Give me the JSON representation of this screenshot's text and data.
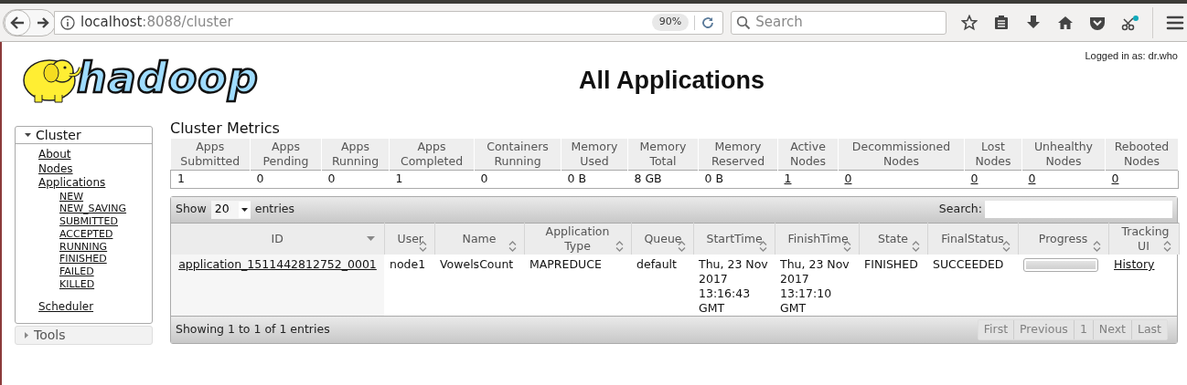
{
  "browser": {
    "url_host": "localhost",
    "url_path": ":8088/cluster",
    "zoom": "90%",
    "search_placeholder": "Search"
  },
  "header": {
    "logo_text": "hadoop",
    "logged_in": "Logged in as: dr.who",
    "title": "All Applications"
  },
  "sidebar": [
    {
      "label": "Cluster",
      "expanded": true,
      "items": [
        {
          "label": "About"
        },
        {
          "label": "Nodes"
        },
        {
          "label": "Applications",
          "children": [
            {
              "label": "NEW"
            },
            {
              "label": "NEW_SAVING"
            },
            {
              "label": "SUBMITTED"
            },
            {
              "label": "ACCEPTED"
            },
            {
              "label": "RUNNING"
            },
            {
              "label": "FINISHED"
            },
            {
              "label": "FAILED"
            },
            {
              "label": "KILLED"
            }
          ]
        },
        {
          "label": "Scheduler"
        }
      ]
    },
    {
      "label": "Tools",
      "expanded": false
    }
  ],
  "metrics": {
    "title": "Cluster Metrics",
    "columns": [
      "Apps Submitted",
      "Apps Pending",
      "Apps Running",
      "Apps Completed",
      "Containers Running",
      "Memory Used",
      "Memory Total",
      "Memory Reserved",
      "Active Nodes",
      "Decommissioned Nodes",
      "Lost Nodes",
      "Unhealthy Nodes",
      "Rebooted Nodes"
    ],
    "values": [
      {
        "text": "1",
        "link": false
      },
      {
        "text": "0",
        "link": false
      },
      {
        "text": "0",
        "link": false
      },
      {
        "text": "1",
        "link": false
      },
      {
        "text": "0",
        "link": false
      },
      {
        "text": "0 B",
        "link": false
      },
      {
        "text": "8 GB",
        "link": false
      },
      {
        "text": "0 B",
        "link": false
      },
      {
        "text": "1",
        "link": true
      },
      {
        "text": "0",
        "link": true
      },
      {
        "text": "0",
        "link": true
      },
      {
        "text": "0",
        "link": true
      },
      {
        "text": "0",
        "link": true
      }
    ]
  },
  "apps": {
    "show_label": "Show",
    "page_size": "20",
    "entries_label": "entries",
    "search_label": "Search:",
    "columns": [
      {
        "label": "ID",
        "sorted": true
      },
      {
        "label": "User",
        "sorted": false
      },
      {
        "label": "Name",
        "sorted": false
      },
      {
        "label": "Application Type",
        "sorted": false
      },
      {
        "label": "Queue",
        "sorted": false
      },
      {
        "label": "StartTime",
        "sorted": false
      },
      {
        "label": "FinishTime",
        "sorted": false
      },
      {
        "label": "State",
        "sorted": false
      },
      {
        "label": "FinalStatus",
        "sorted": false
      },
      {
        "label": "Progress",
        "sorted": false
      },
      {
        "label": "Tracking UI",
        "sorted": false
      }
    ],
    "rows": [
      {
        "cells": [
          {
            "kind": "link",
            "text": "application_1511442812752_0001"
          },
          {
            "kind": "text",
            "text": "node1"
          },
          {
            "kind": "text",
            "text": "VowelsCount"
          },
          {
            "kind": "text",
            "text": "MAPREDUCE"
          },
          {
            "kind": "text",
            "text": "default"
          },
          {
            "kind": "text",
            "text": "Thu, 23 Nov 2017 13:16:43 GMT"
          },
          {
            "kind": "text",
            "text": "Thu, 23 Nov 2017 13:17:10 GMT"
          },
          {
            "kind": "text",
            "text": "FINISHED"
          },
          {
            "kind": "text",
            "text": "SUCCEEDED"
          },
          {
            "kind": "progress",
            "level": 1
          },
          {
            "kind": "link",
            "text": "History"
          }
        ]
      }
    ],
    "info": "Showing 1 to 1 of 1 entries",
    "pagination": [
      {
        "label": "First",
        "disabled": true
      },
      {
        "label": "Previous",
        "disabled": true
      },
      {
        "label": "1",
        "disabled": true
      },
      {
        "label": "Next",
        "disabled": true
      },
      {
        "label": "Last",
        "disabled": true
      }
    ]
  }
}
